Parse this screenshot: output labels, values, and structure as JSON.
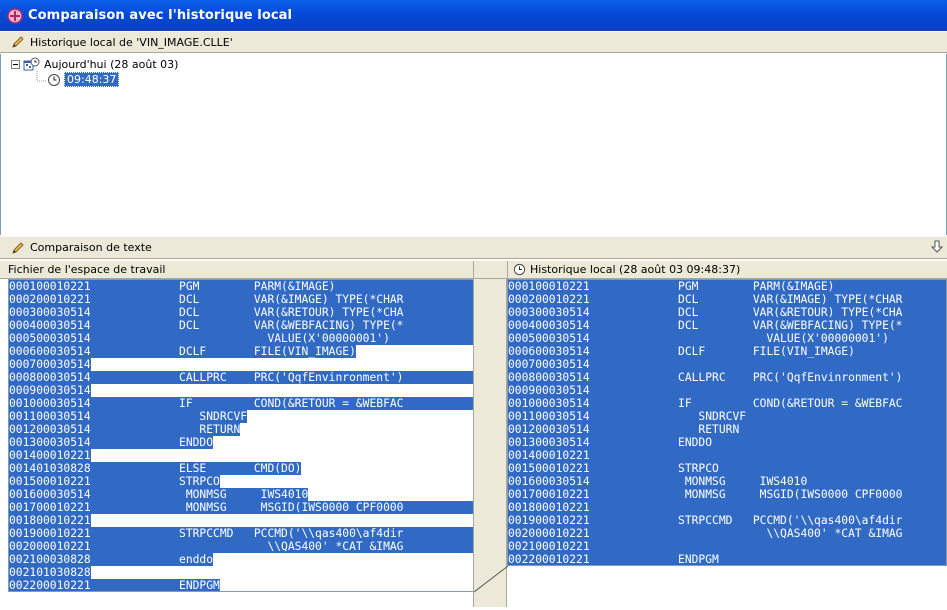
{
  "window": {
    "title": "Comparaison avec l'historique local"
  },
  "history_header": {
    "label": "Historique local de 'VIN_IMAGE.CLLE'"
  },
  "tree": {
    "day_label": "Aujourd'hui (28 août 03)",
    "time_label": "09:48:37"
  },
  "compare_header": {
    "label": "Comparaison de texte"
  },
  "left_header": {
    "label": "Fichier de l'espace de travail"
  },
  "right_header": {
    "label": "Historique local (28 août 03 09:48:37)"
  },
  "left_lines": [
    {
      "seq": "000100010221",
      "code": "             PGM        PARM(&IMAGE)",
      "hl": "full"
    },
    {
      "seq": "000200010221",
      "code": "             DCL        VAR(&IMAGE) TYPE(*CHAR",
      "hl": "full"
    },
    {
      "seq": "000300030514",
      "code": "             DCL        VAR(&RETOUR) TYPE(*CHA",
      "hl": "full"
    },
    {
      "seq": "000400030514",
      "code": "             DCL        VAR(&WEBFACING) TYPE(*",
      "hl": "full"
    },
    {
      "seq": "000500030514",
      "code": "                          VALUE(X'00000001')",
      "hl": "full"
    },
    {
      "seq": "000600030514",
      "code": "             DCLF       FILE(VIN_IMAGE)",
      "hl": "partial"
    },
    {
      "seq": "000700030514",
      "code": "",
      "hl": "seq"
    },
    {
      "seq": "000800030514",
      "code": "             CALLPRC    PRC('QqfEnvinronment')",
      "hl": "full"
    },
    {
      "seq": "000900030514",
      "code": "",
      "hl": "seq"
    },
    {
      "seq": "001000030514",
      "code": "             IF         COND(&RETOUR = &WEBFAC",
      "hl": "full"
    },
    {
      "seq": "001100030514",
      "code": "                SNDRCVF",
      "hl": "partial"
    },
    {
      "seq": "001200030514",
      "code": "                RETURN",
      "hl": "partial"
    },
    {
      "seq": "001300030514",
      "code": "             ENDDO",
      "hl": "partial"
    },
    {
      "seq": "001400010221",
      "code": "",
      "hl": "seq"
    },
    {
      "seq": "001401030828",
      "code": "             ELSE       CMD(DO)",
      "hl": "partial"
    },
    {
      "seq": "001500010221",
      "code": "             STRPCO",
      "hl": "partial"
    },
    {
      "seq": "001600030514",
      "code": "              MONMSG     IWS4010",
      "hl": "partial"
    },
    {
      "seq": "001700010221",
      "code": "              MONMSG     MSGID(IWS0000 CPF0000",
      "hl": "full"
    },
    {
      "seq": "001800010221",
      "code": "",
      "hl": "seq"
    },
    {
      "seq": "001900010221",
      "code": "             STRPCCMD   PCCMD('\\\\qas400\\af4dir",
      "hl": "full"
    },
    {
      "seq": "002000010221",
      "code": "                          \\\\QAS400' *CAT &IMAG",
      "hl": "full"
    },
    {
      "seq": "002100030828",
      "code": "             enddo",
      "hl": "partial"
    },
    {
      "seq": "002101030828",
      "code": "",
      "hl": "seq"
    },
    {
      "seq": "002200010221",
      "code": "             ENDPGM",
      "hl": "partial"
    }
  ],
  "right_lines": [
    {
      "seq": "000100010221",
      "code": "             PGM        PARM(&IMAGE)"
    },
    {
      "seq": "000200010221",
      "code": "             DCL        VAR(&IMAGE) TYPE(*CHAR"
    },
    {
      "seq": "000300030514",
      "code": "             DCL        VAR(&RETOUR) TYPE(*CHA"
    },
    {
      "seq": "000400030514",
      "code": "             DCL        VAR(&WEBFACING) TYPE(*"
    },
    {
      "seq": "000500030514",
      "code": "                          VALUE(X'00000001')"
    },
    {
      "seq": "000600030514",
      "code": "             DCLF       FILE(VIN_IMAGE)"
    },
    {
      "seq": "000700030514",
      "code": ""
    },
    {
      "seq": "000800030514",
      "code": "             CALLPRC    PRC('QqfEnvinronment')"
    },
    {
      "seq": "000900030514",
      "code": ""
    },
    {
      "seq": "001000030514",
      "code": "             IF         COND(&RETOUR = &WEBFAC"
    },
    {
      "seq": "001100030514",
      "code": "                SNDRCVF"
    },
    {
      "seq": "001200030514",
      "code": "                RETURN"
    },
    {
      "seq": "001300030514",
      "code": "             ENDDO"
    },
    {
      "seq": "001400010221",
      "code": ""
    },
    {
      "seq": "001500010221",
      "code": "             STRPCO"
    },
    {
      "seq": "001600030514",
      "code": "              MONMSG     IWS4010"
    },
    {
      "seq": "001700010221",
      "code": "              MONMSG     MSGID(IWS0000 CPF0000"
    },
    {
      "seq": "001800010221",
      "code": ""
    },
    {
      "seq": "001900010221",
      "code": "             STRPCCMD   PCCMD('\\\\qas400\\af4dir"
    },
    {
      "seq": "002000010221",
      "code": "                          \\\\QAS400' *CAT &IMAG"
    },
    {
      "seq": "002100010221",
      "code": ""
    },
    {
      "seq": "002200010221",
      "code": "             ENDPGM"
    }
  ],
  "colors": {
    "selection": "#316ac5",
    "titlebar": "#0548d6",
    "chrome": "#ece9d8"
  }
}
